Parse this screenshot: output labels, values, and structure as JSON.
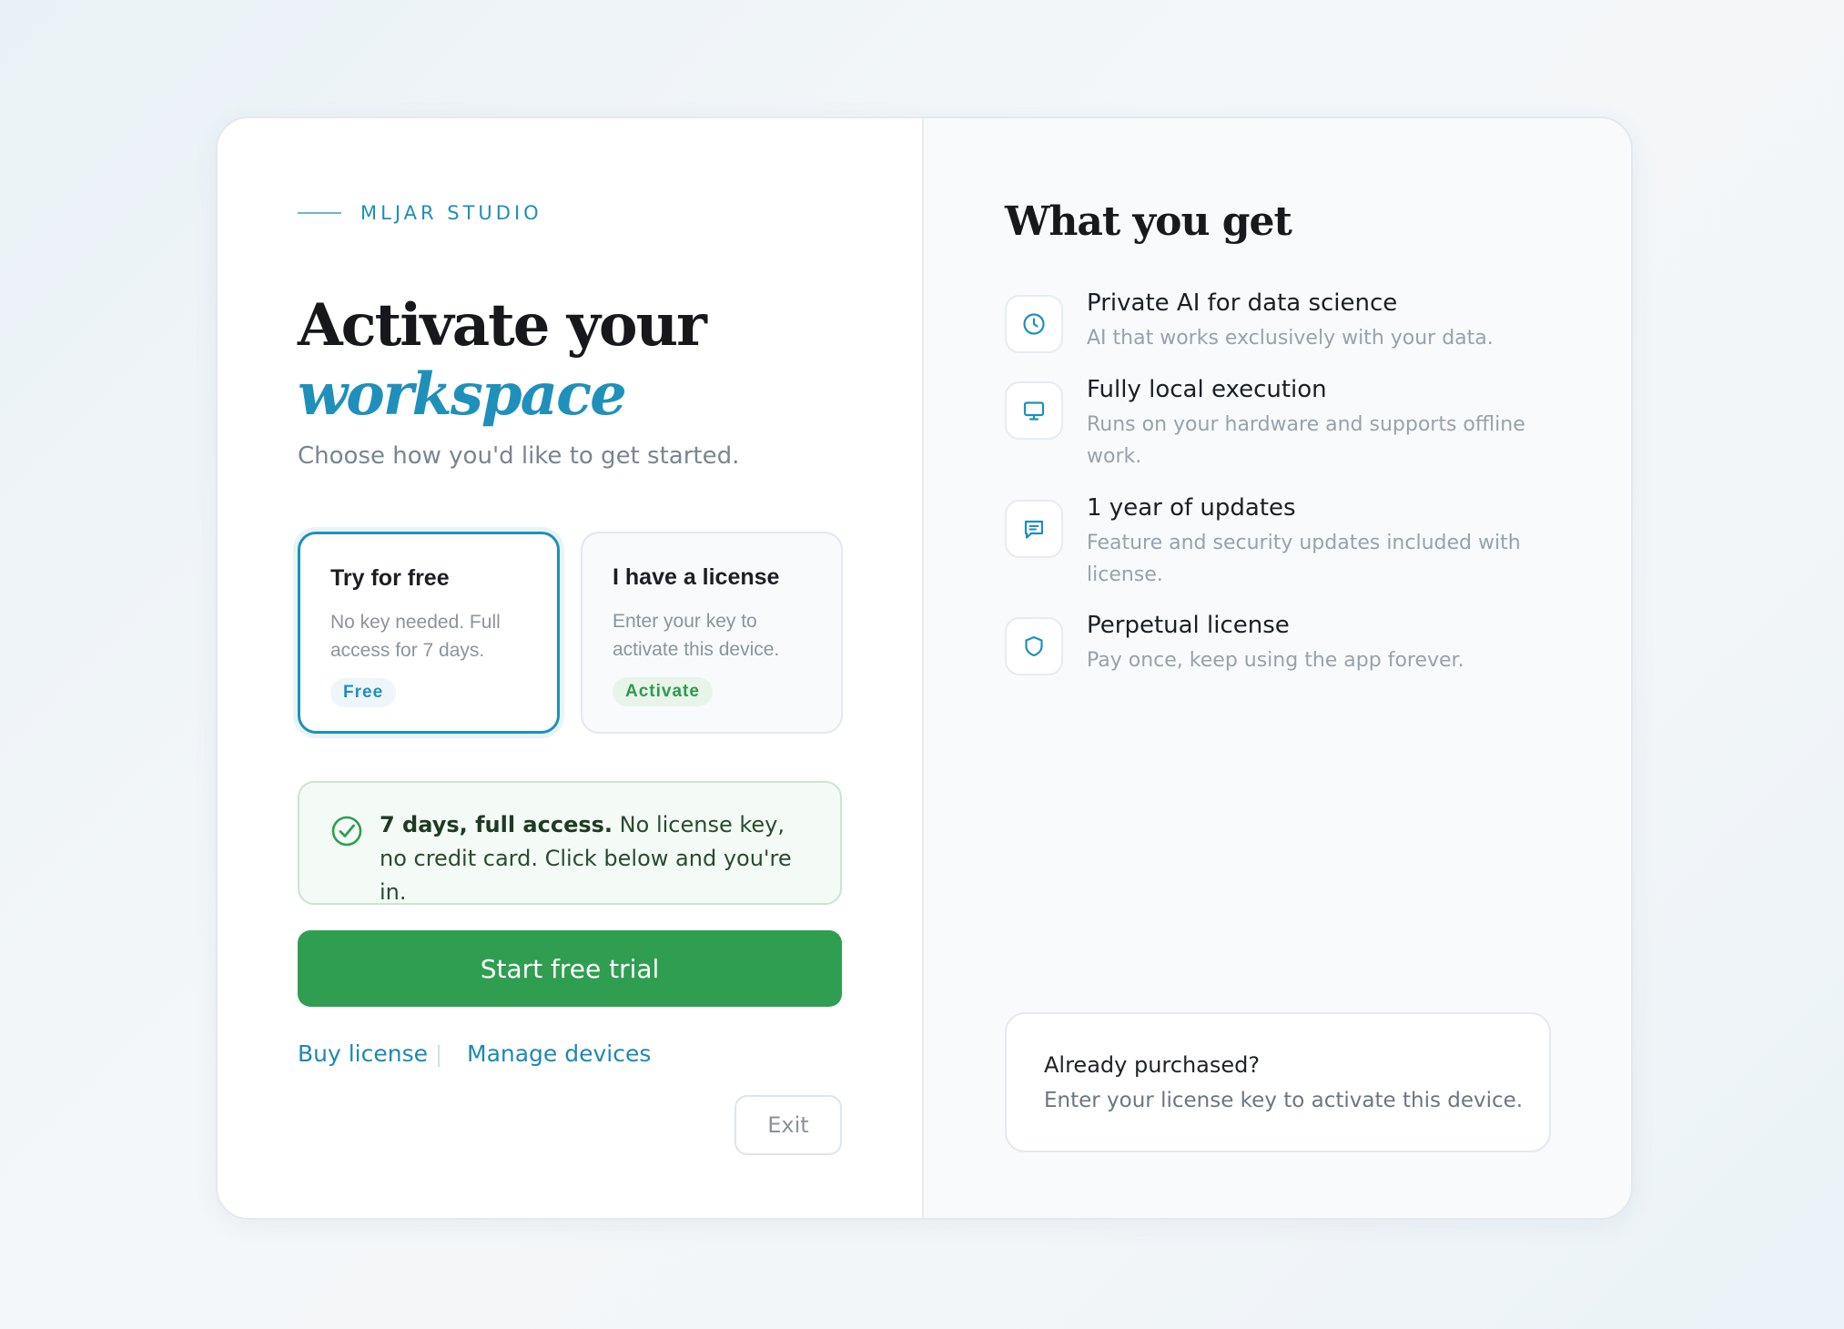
{
  "brand": {
    "name": "MLJAR STUDIO"
  },
  "hero": {
    "title_line1": "Activate your",
    "title_line2": "workspace",
    "subtitle": "Choose how you'd like to get started."
  },
  "options": [
    {
      "title": "Try for free",
      "description": "No key needed. Full access for 7 days.",
      "badge": "Free",
      "selected": true
    },
    {
      "title": "I have a license",
      "description": "Enter your key to activate this device.",
      "badge": "Activate",
      "selected": false
    }
  ],
  "notice": {
    "bold": "7 days, full access.",
    "text": " No license key, no credit card. Click below and you're in."
  },
  "cta": {
    "label": "Start free trial"
  },
  "footer": {
    "buy_license": "Buy license",
    "manage_devices": "Manage devices",
    "exit": "Exit"
  },
  "benefits": {
    "title": "What you get",
    "items": [
      {
        "icon": "clock-icon",
        "title": "Private AI for data science",
        "description": "AI that works exclusively with your data."
      },
      {
        "icon": "monitor-icon",
        "title": "Fully local execution",
        "description": "Runs on your hardware and supports offline work."
      },
      {
        "icon": "chat-icon",
        "title": "1 year of updates",
        "description": "Feature and security updates included with license."
      },
      {
        "icon": "shield-icon",
        "title": "Perpetual license",
        "description": "Pay once, keep using the app forever."
      }
    ]
  },
  "already_purchased": {
    "title": "Already purchased?",
    "description": "Enter your license key to activate this device."
  },
  "colors": {
    "accent": "#1e90bb",
    "success": "#2f9e50",
    "text": "#16181c",
    "muted": "#7a8590"
  }
}
